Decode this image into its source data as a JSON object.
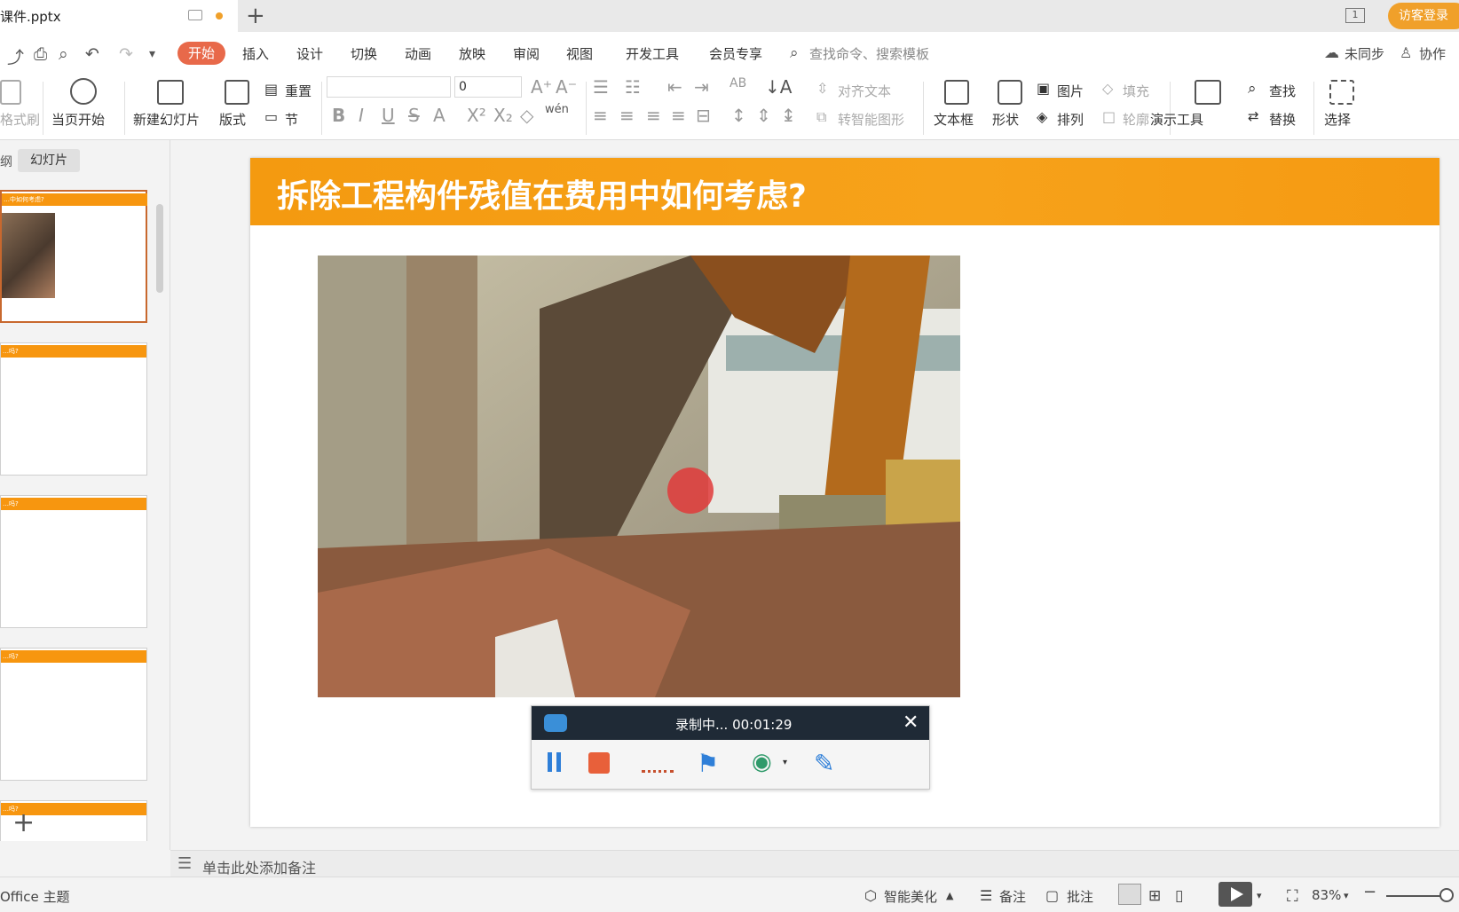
{
  "titlebar": {
    "doc_name": "课件.pptx",
    "new_tab": "+",
    "page_indicator": "1",
    "visitor_login": "访客登录"
  },
  "menu": {
    "tabs": [
      "开始",
      "插入",
      "设计",
      "切换",
      "动画",
      "放映",
      "审阅",
      "视图",
      "开发工具",
      "会员专享"
    ],
    "search_placeholder": "查找命令、搜索模板",
    "sync": "未同步",
    "collab": "协作"
  },
  "ribbon": {
    "format_painter": "格式刷",
    "play_from_current": "当页开始",
    "new_slide": "新建幻灯片",
    "layout": "版式",
    "reset": "重置",
    "section": "节",
    "font_name": "",
    "font_size": "0",
    "align_text": "对齐文本",
    "smartart": "转智能图形",
    "textbox": "文本框",
    "shape": "形状",
    "picture": "图片",
    "arrange": "排列",
    "fill": "填充",
    "outline": "轮廓",
    "present_tools": "演示工具",
    "find": "查找",
    "replace": "替换",
    "select": "选择",
    "wen": "wén"
  },
  "left_panel": {
    "tab_outline": "纲",
    "tab_slides": "幻灯片",
    "thumb_titles": [
      "…中如何考虑?",
      "…吗?",
      "…吗?",
      "…吗?",
      "…吗?"
    ]
  },
  "slide": {
    "title": "拆除工程构件残值在费用中如何考虑?",
    "accent": "#f49a10"
  },
  "recorder": {
    "status": "录制中... 00:01:29"
  },
  "notes": {
    "placeholder": "单击此处添加备注"
  },
  "status": {
    "theme": "Office 主题",
    "beautify": "智能美化",
    "notes": "备注",
    "comments": "批注",
    "zoom": "83%"
  }
}
